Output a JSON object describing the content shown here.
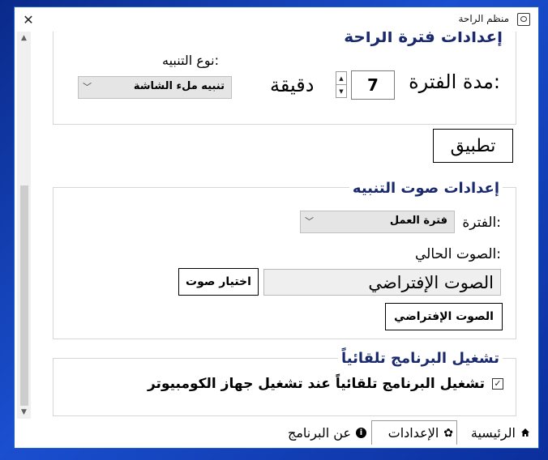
{
  "window": {
    "title": "منظم الراحة",
    "close_glyph": "✕"
  },
  "section1": {
    "partial_heading": "إعدادات فترة الراحة",
    "duration_label": "مدة الفترة:",
    "duration_value": "7",
    "duration_unit": "دقيقة",
    "alert_type_label": "نوع التنبيه:",
    "alert_type_value": "تنبيه ملء الشاشة"
  },
  "apply_button": "تطبيق",
  "sound": {
    "heading": "إعدادات صوت التنبيه",
    "period_label": "الفترة:",
    "period_value": "فترة العمل",
    "current_label": "الصوت الحالي:",
    "current_value": "الصوت الإفتراضي",
    "choose_button": "اختيار صوت",
    "default_button": "الصوت الإفتراضي"
  },
  "autostart": {
    "heading": "تشغيل البرنامج تلقائياً",
    "checkbox_label": "تشغيل البرنامج تلقائياً عند تشغيل جهاز الكومبيوتر",
    "checked": true
  },
  "tabs": [
    {
      "label": "الرئيسية",
      "icon": "home-icon",
      "selected": false
    },
    {
      "label": "الإعدادات",
      "icon": "gear-icon",
      "selected": true
    },
    {
      "label": "عن البرنامج",
      "icon": "info-icon",
      "selected": false
    }
  ]
}
